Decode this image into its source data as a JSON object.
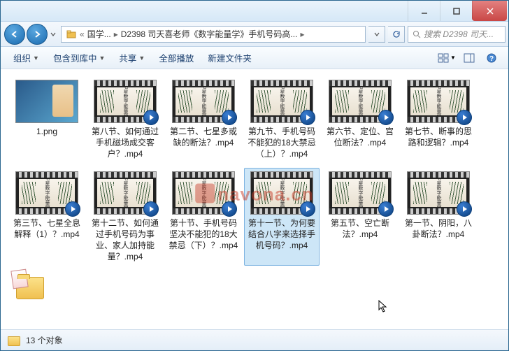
{
  "titlebar": {},
  "nav": {
    "breadcrumb_prefix": "«",
    "crumb1": "国学...",
    "crumb2": "D2398 司天喜老师《数字能量学》手机号码高...",
    "search_placeholder": "搜索 D2398 司天..."
  },
  "toolbar": {
    "organize": "组织",
    "include": "包含到库中",
    "share": "共享",
    "playall": "全部播放",
    "newfolder": "新建文件夹"
  },
  "files": [
    {
      "name": "1.png",
      "type": "image"
    },
    {
      "name": "第八节、如何通过手机磁场成交客户？.mp4",
      "type": "video"
    },
    {
      "name": "第二节、七星多或缺的断法？.mp4",
      "type": "video"
    },
    {
      "name": "第九节、手机号码不能犯的18大禁忌（上）？.mp4",
      "type": "video"
    },
    {
      "name": "第六节、定位、宫位断法？.mp4",
      "type": "video"
    },
    {
      "name": "第七节、断事的思路和逻辑？.mp4",
      "type": "video"
    },
    {
      "name": "第三节、七星全息解释（1）？.mp4",
      "type": "video"
    },
    {
      "name": "第十二节、如何通过手机号码为事业、家人加持能量？.mp4",
      "type": "video"
    },
    {
      "name": "第十节、手机号码坚决不能犯的18大禁忌（下）？.mp4",
      "type": "video"
    },
    {
      "name": "第十一节、为何要结合八字来选择手机号码？.mp4",
      "type": "video",
      "selected": true
    },
    {
      "name": "第五节、空亡断法？.mp4",
      "type": "video"
    },
    {
      "name": "第一节、阴阳，八卦断法？.mp4",
      "type": "video"
    }
  ],
  "watermark": "navona.cn",
  "status": {
    "count": "13 个对象"
  },
  "thumb_text": "七星数字能量学"
}
